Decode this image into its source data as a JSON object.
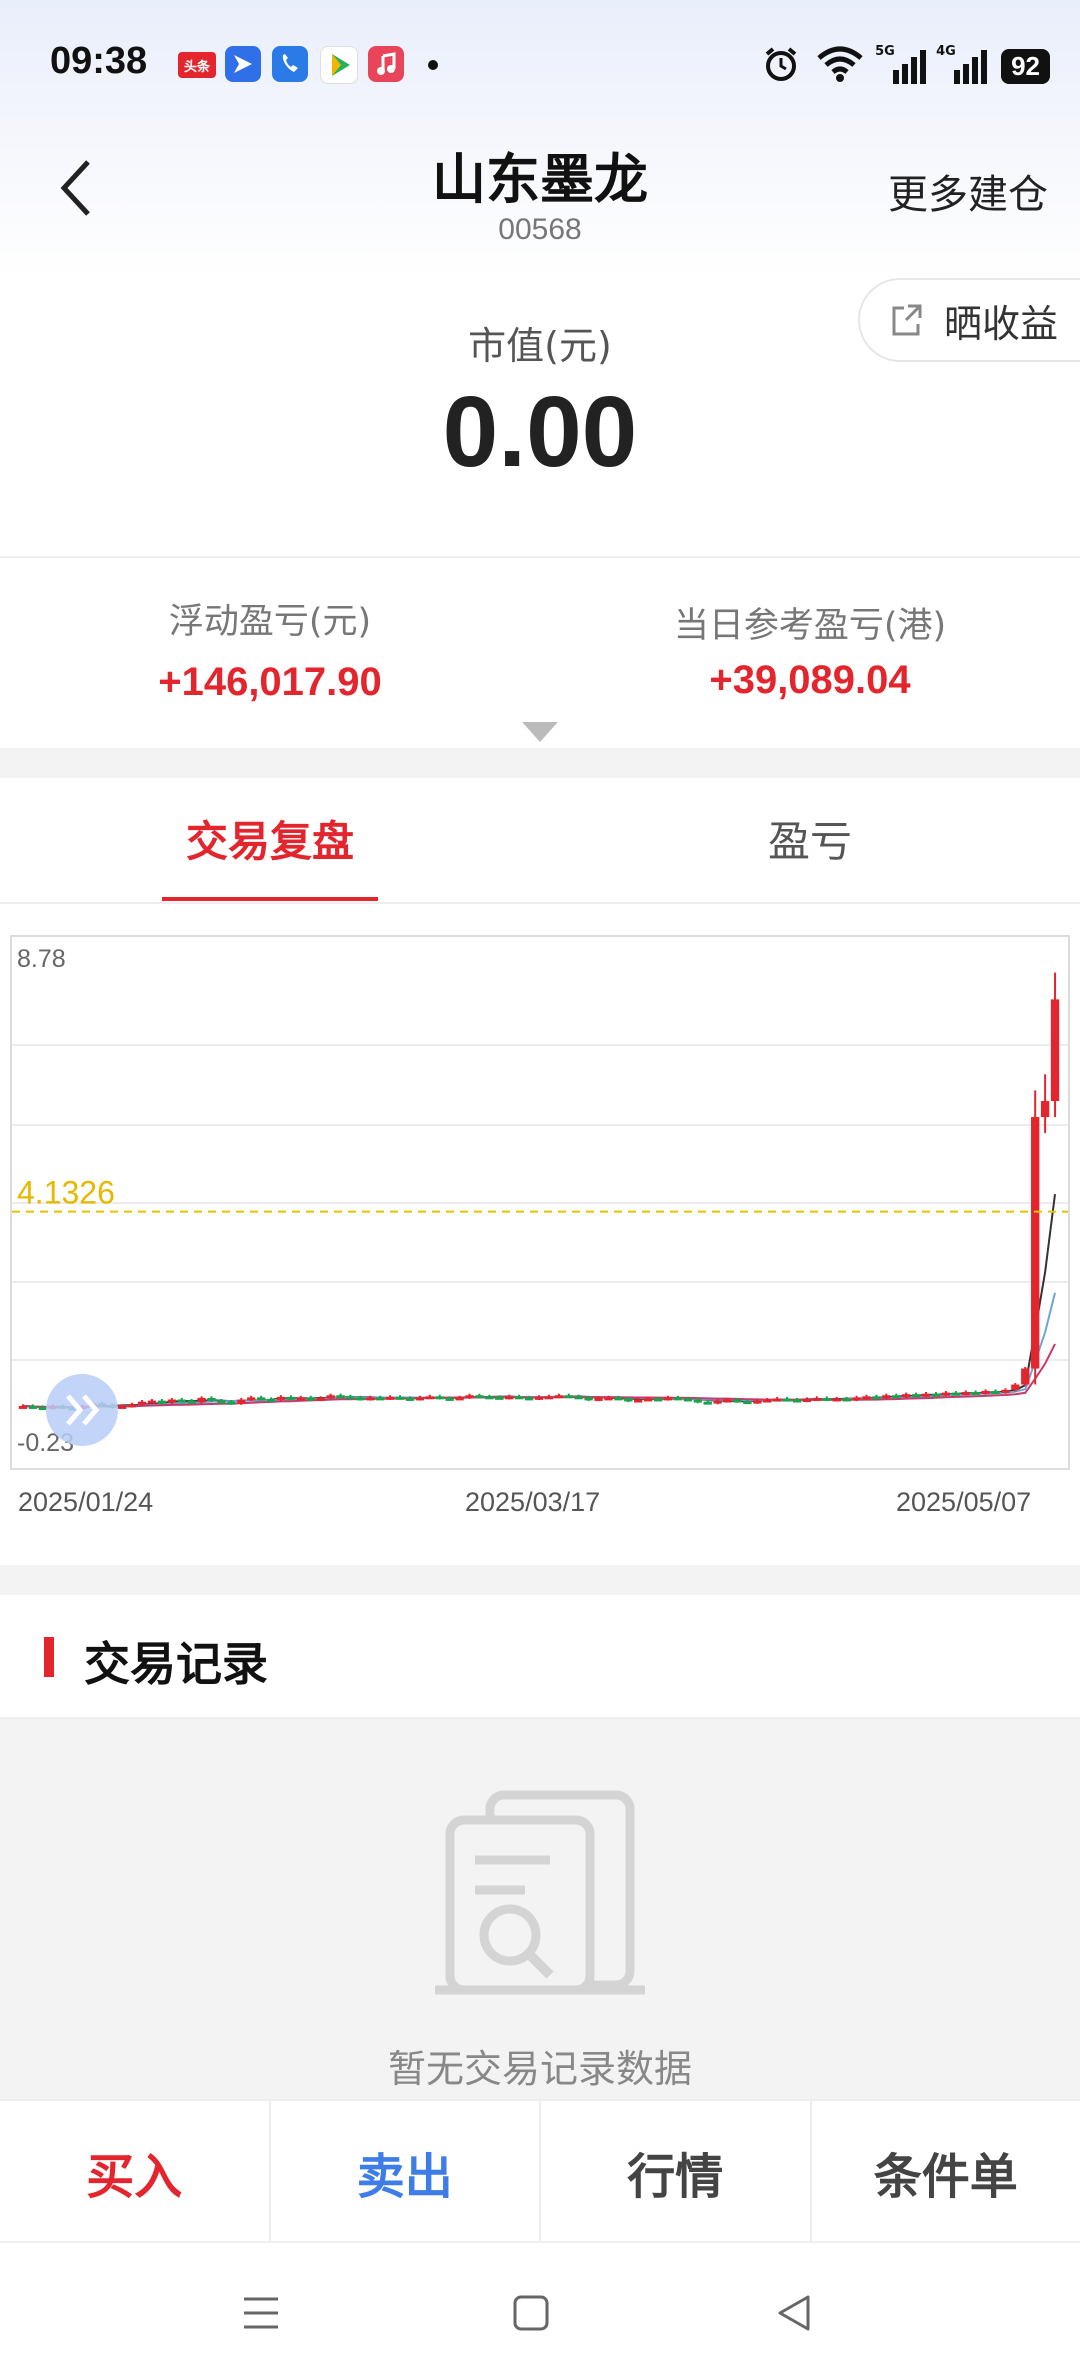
{
  "status_bar": {
    "time": "09:38",
    "battery": "92",
    "toutiao_label": "头条",
    "sim1_label": "5G",
    "sim2_label": "4G"
  },
  "header": {
    "title": "山东墨龙",
    "code": "00568",
    "more_action": "更多建仓",
    "share_label": "晒收益"
  },
  "market_value": {
    "label": "市值(元)",
    "value": "0.00"
  },
  "pl": {
    "floating_label": "浮动盈亏(元)",
    "floating_value": "+146,017.90",
    "daily_label": "当日参考盈亏(港)",
    "daily_value": "+39,089.04"
  },
  "tabs": [
    {
      "label": "交易复盘",
      "active": true
    },
    {
      "label": "盈亏",
      "active": false
    }
  ],
  "chart_data": {
    "type": "candlestick",
    "y_top_label": "8.78",
    "y_bottom_label": "-0.23",
    "cost_line_label": "4.1326",
    "cost_line_value": 4.1326,
    "ylim": [
      -0.23,
      8.78
    ],
    "x_labels": [
      "2025/01/24",
      "2025/03/17",
      "2025/05/07"
    ],
    "grid": true,
    "colors": {
      "up": "#e3262d",
      "down": "#1aa34a",
      "cost_line": "#e6c200"
    },
    "closes": [
      0.5,
      0.48,
      0.46,
      0.5,
      0.47,
      0.45,
      0.5,
      0.55,
      0.52,
      0.48,
      0.5,
      0.53,
      0.58,
      0.6,
      0.56,
      0.62,
      0.6,
      0.57,
      0.65,
      0.6,
      0.58,
      0.55,
      0.62,
      0.66,
      0.63,
      0.62,
      0.67,
      0.64,
      0.66,
      0.62,
      0.65,
      0.7,
      0.68,
      0.66,
      0.63,
      0.66,
      0.64,
      0.67,
      0.65,
      0.63,
      0.66,
      0.68,
      0.65,
      0.64,
      0.66,
      0.7,
      0.68,
      0.67,
      0.65,
      0.68,
      0.66,
      0.64,
      0.67,
      0.68,
      0.7,
      0.68,
      0.66,
      0.62,
      0.65,
      0.66,
      0.64,
      0.6,
      0.62,
      0.64,
      0.63,
      0.66,
      0.64,
      0.62,
      0.58,
      0.56,
      0.6,
      0.62,
      0.59,
      0.57,
      0.6,
      0.62,
      0.64,
      0.62,
      0.6,
      0.63,
      0.65,
      0.63,
      0.64,
      0.62,
      0.66,
      0.68,
      0.66,
      0.7,
      0.68,
      0.72,
      0.7,
      0.73,
      0.71,
      0.75,
      0.73,
      0.76,
      0.74,
      0.78,
      0.76,
      0.8,
      0.9,
      1.2,
      5.9,
      6.2,
      8.1
    ]
  },
  "records": {
    "title": "交易记录",
    "empty_text": "暂无交易记录数据"
  },
  "actions": [
    {
      "label": "买入"
    },
    {
      "label": "卖出"
    },
    {
      "label": "行情"
    },
    {
      "label": "条件单"
    }
  ]
}
